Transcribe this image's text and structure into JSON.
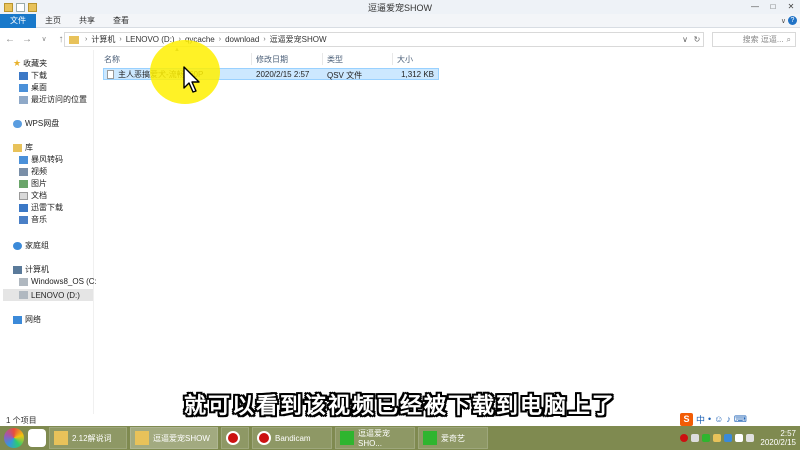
{
  "window": {
    "title": "逗逼爱宠SHOW",
    "minimize": "—",
    "maximize": "□",
    "close": "✕"
  },
  "ribbon": {
    "tabs": [
      "文件",
      "主页",
      "共享",
      "查看"
    ]
  },
  "address": {
    "crumbs": [
      "计算机",
      "LENOVO (D:)",
      "qycache",
      "download",
      "逗逼爱宠SHOW"
    ],
    "search_placeholder": "搜索 逗逼..."
  },
  "navpane": {
    "favorites": "收藏夹",
    "downloads": "下载",
    "desktop": "桌面",
    "recent": "最近访问的位置",
    "wps": "WPS网盘",
    "library": "库",
    "baofeng": "暴风转码",
    "videos": "视频",
    "pictures": "图片",
    "documents": "文档",
    "xunlei": "迅雷下载",
    "music": "音乐",
    "homegroup": "家庭组",
    "computer": "计算机",
    "windows_os": "Windows8_OS (C:)",
    "lenovo": "LENOVO (D:)",
    "network": "网络"
  },
  "columns": {
    "name": "名称",
    "modified": "修改日期",
    "type": "类型",
    "size": "大小"
  },
  "file": {
    "name": "主人恶搞爱犬-流畅360P",
    "modified": "2020/2/15 2:57",
    "type": "QSV 文件",
    "size": "1,312 KB"
  },
  "status": {
    "count": "1 个项目"
  },
  "subtitle": "就可以看到该视频已经被下载到电脑上了",
  "taskbar": {
    "apps": [
      {
        "label": "2.12解说词",
        "color": "#e8c25a"
      },
      {
        "label": "逗逼爱宠SHOW",
        "color": "#e8c25a"
      },
      {
        "label": "",
        "color": "#cc1111"
      },
      {
        "label": "Bandicam",
        "color": "#cc1111"
      },
      {
        "label": "逗逼爱宠SHO...",
        "color": "#2fb52f"
      },
      {
        "label": "爱奇艺",
        "color": "#2fb52f"
      }
    ],
    "clock_time": "2:57",
    "clock_date": "2020/2/15"
  },
  "ime": {
    "brand": "S",
    "mode": "中"
  }
}
